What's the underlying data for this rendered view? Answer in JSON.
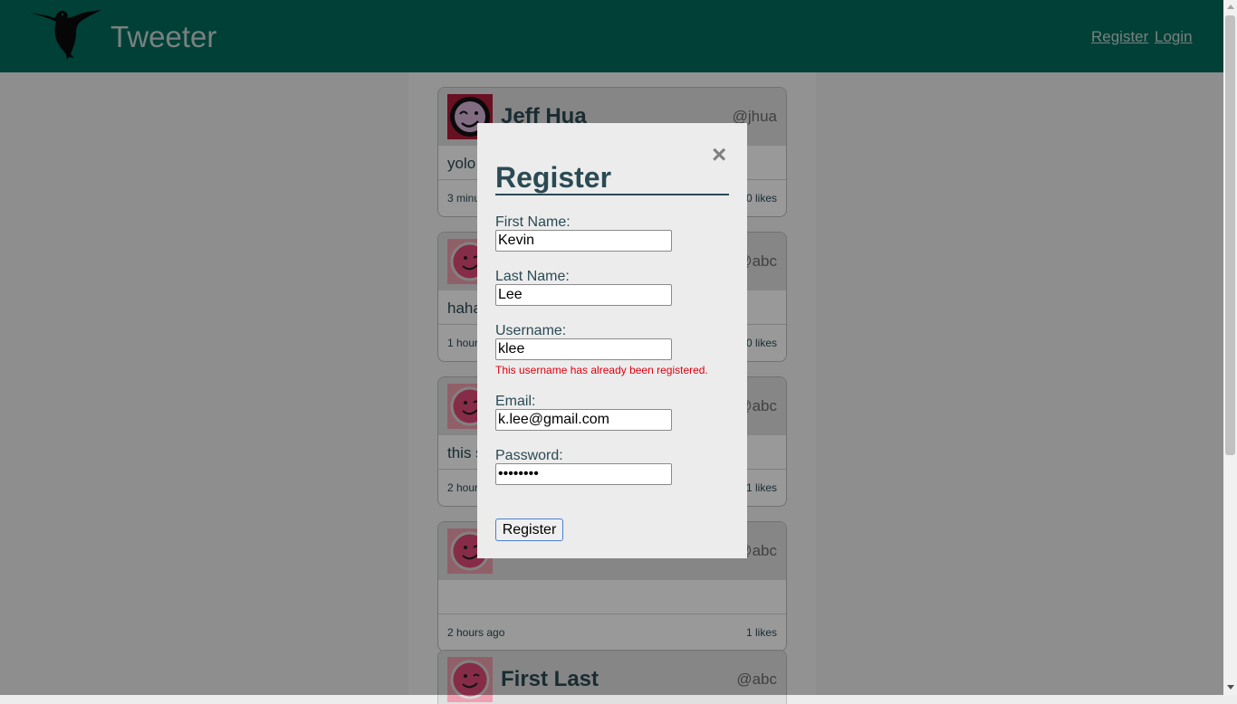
{
  "header": {
    "brand": "Tweeter",
    "nav": {
      "register": "Register",
      "login": "Login"
    }
  },
  "feed": {
    "tweets": [
      {
        "name": "Jeff Hua",
        "handle": "@jhua",
        "text": "yolo",
        "time": "3 minu",
        "likes": "0  likes"
      },
      {
        "name": "",
        "handle": "@abc",
        "text": "haha",
        "time": "1 hour",
        "likes": "0  likes"
      },
      {
        "name": "",
        "handle": "@abc",
        "text": "this s",
        "time": "2 hour",
        "likes": "1  likes"
      },
      {
        "name": "",
        "handle": "@abc",
        "text": "",
        "time": "2 hours ago",
        "likes": "1  likes"
      },
      {
        "name": "First Last",
        "handle": "@abc",
        "text": "",
        "time": "",
        "likes": ""
      }
    ]
  },
  "modal": {
    "title": "Register",
    "close": "×",
    "fields": {
      "first_name": {
        "label": "First Name:",
        "value": "Kevin"
      },
      "last_name": {
        "label": "Last Name:",
        "value": "Lee"
      },
      "username": {
        "label": "Username:",
        "value": "klee",
        "error": "This username has already been registered."
      },
      "email": {
        "label": "Email:",
        "value": "k.lee@gmail.com"
      },
      "password": {
        "label": "Password:",
        "value": "••••••••"
      }
    },
    "submit_label": "Register"
  },
  "colors": {
    "header_bg": "#006b5c",
    "text_primary": "#2a4a54",
    "error": "#e0000f"
  }
}
